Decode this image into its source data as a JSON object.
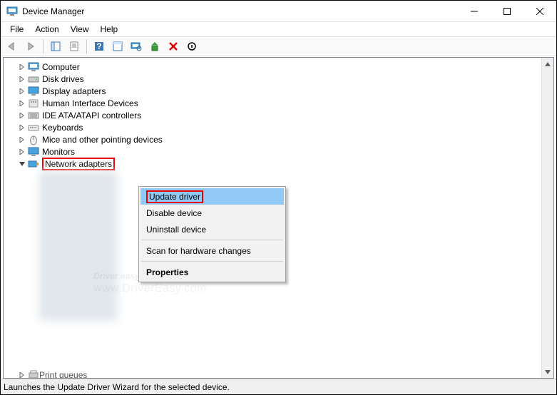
{
  "window": {
    "title": "Device Manager"
  },
  "menu": {
    "file": "File",
    "action": "Action",
    "view": "View",
    "help": "Help"
  },
  "tree": {
    "items": [
      {
        "label": "Computer"
      },
      {
        "label": "Disk drives"
      },
      {
        "label": "Display adapters"
      },
      {
        "label": "Human Interface Devices"
      },
      {
        "label": "IDE ATA/ATAPI controllers"
      },
      {
        "label": "Keyboards"
      },
      {
        "label": "Mice and other pointing devices"
      },
      {
        "label": "Monitors"
      },
      {
        "label": "Network adapters"
      },
      {
        "label": "Print queues"
      }
    ]
  },
  "context_menu": {
    "update": "Update driver",
    "disable": "Disable device",
    "uninstall": "Uninstall device",
    "scan": "Scan for hardware changes",
    "properties": "Properties"
  },
  "statusbar": {
    "text": "Launches the Update Driver Wizard for the selected device."
  },
  "watermark": {
    "line1": "Driver easy",
    "line2": "www.DriverEasy.com"
  }
}
